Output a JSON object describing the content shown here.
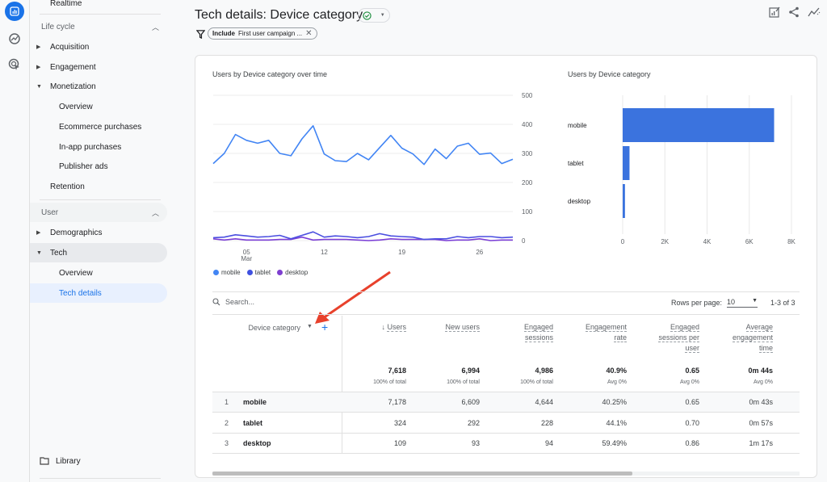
{
  "sidebar": {
    "rail_icons": [
      "reports-icon",
      "explore-icon",
      "advertising-icon"
    ],
    "realtime": "Realtime",
    "lifecycle_header": "Life cycle",
    "acquisition": "Acquisition",
    "engagement": "Engagement",
    "monetization": "Monetization",
    "monetization_items": [
      "Overview",
      "Ecommerce purchases",
      "In-app purchases",
      "Publisher ads"
    ],
    "retention": "Retention",
    "user_header": "User",
    "demographics": "Demographics",
    "tech": "Tech",
    "tech_items": [
      "Overview",
      "Tech details"
    ],
    "library": "Library"
  },
  "header": {
    "title": "Tech details: Device category",
    "status": "check",
    "filter_include": "Include",
    "filter_text": "First user campaign ..."
  },
  "line_chart_title": "Users by Device category over time",
  "bar_chart_title": "Users by Device category",
  "legend": [
    {
      "name": "mobile",
      "color": "#4285f4"
    },
    {
      "name": "tablet",
      "color": "#3f51e0"
    },
    {
      "name": "desktop",
      "color": "#7e3fd0"
    }
  ],
  "chart_data": [
    {
      "type": "line",
      "title": "Users by Device category over time",
      "x_ticks": [
        "05\nMar",
        "12",
        "19",
        "26"
      ],
      "y_ticks": [
        0,
        100,
        200,
        300,
        400,
        500
      ],
      "ylim": [
        0,
        500
      ],
      "x_start_day": 2,
      "series": [
        {
          "name": "mobile",
          "color": "#4285f4",
          "values": [
            265,
            300,
            365,
            345,
            335,
            345,
            300,
            292,
            350,
            395,
            298,
            275,
            272,
            300,
            278,
            320,
            362,
            318,
            298,
            262,
            315,
            282,
            325,
            335,
            297,
            301,
            265,
            280
          ]
        },
        {
          "name": "tablet",
          "color": "#4b4fe0",
          "values": [
            10,
            12,
            20,
            16,
            12,
            14,
            18,
            6,
            18,
            30,
            12,
            16,
            14,
            10,
            14,
            24,
            16,
            14,
            12,
            4,
            6,
            6,
            14,
            10,
            14,
            14,
            10,
            12
          ]
        },
        {
          "name": "desktop",
          "color": "#7b3fd6",
          "values": [
            6,
            2,
            6,
            2,
            2,
            2,
            4,
            4,
            12,
            2,
            4,
            4,
            4,
            2,
            0,
            2,
            6,
            4,
            4,
            4,
            4,
            0,
            2,
            2,
            6,
            0,
            2,
            2
          ]
        }
      ]
    },
    {
      "type": "bar",
      "orientation": "horizontal",
      "title": "Users by Device category",
      "categories": [
        "mobile",
        "tablet",
        "desktop"
      ],
      "values": [
        7178,
        324,
        109
      ],
      "x_ticks": [
        "0",
        "2K",
        "4K",
        "6K",
        "8K"
      ],
      "xlim": [
        0,
        8000
      ],
      "color": "#3b73de"
    }
  ],
  "table": {
    "search_placeholder": "Search...",
    "rows_per_page_label": "Rows per page:",
    "rows_per_page": "10",
    "range": "1-3 of 3",
    "dimension_header": "Device category",
    "headers": [
      "Users",
      "New users",
      "Engaged\nsessions",
      "Engagement\nrate",
      "Engaged\nsessions per\nuser",
      "Average\nengagement\ntime"
    ],
    "totals": [
      "7,618",
      "6,994",
      "4,986",
      "40.9%",
      "0.65",
      "0m 44s"
    ],
    "totals_sub": [
      "100% of total",
      "100% of total",
      "100% of total",
      "Avg 0%",
      "Avg 0%",
      "Avg 0%"
    ],
    "rows": [
      {
        "idx": "1",
        "name": "mobile",
        "values": [
          "7,178",
          "6,609",
          "4,644",
          "40.25%",
          "0.65",
          "0m 43s"
        ]
      },
      {
        "idx": "2",
        "name": "tablet",
        "values": [
          "324",
          "292",
          "228",
          "44.1%",
          "0.70",
          "0m 57s"
        ]
      },
      {
        "idx": "3",
        "name": "desktop",
        "values": [
          "109",
          "93",
          "94",
          "59.49%",
          "0.86",
          "1m 17s"
        ]
      }
    ]
  }
}
